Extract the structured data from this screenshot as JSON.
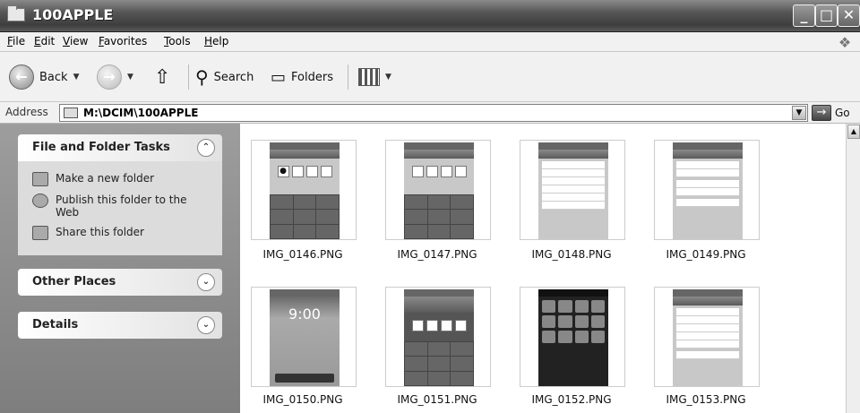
{
  "window": {
    "title": "100APPLE"
  },
  "menu": [
    "File",
    "Edit",
    "View",
    "Favorites",
    "Tools",
    "Help"
  ],
  "toolbar": {
    "back": "Back",
    "search": "Search",
    "folders": "Folders"
  },
  "address": {
    "label": "Address",
    "value": "M:\\DCIM\\100APPLE",
    "go": "Go"
  },
  "tasks_panel": {
    "title": "File and Folder Tasks",
    "items": [
      "Make a new folder",
      "Publish this folder to the Web",
      "Share this folder"
    ]
  },
  "other_places": {
    "title": "Other Places"
  },
  "details": {
    "title": "Details"
  },
  "files": [
    "IMG_0146.PNG",
    "IMG_0147.PNG",
    "IMG_0148.PNG",
    "IMG_0149.PNG",
    "IMG_0150.PNG",
    "IMG_0151.PNG",
    "IMG_0152.PNG",
    "IMG_0153.PNG"
  ],
  "lock_time": "9:00"
}
